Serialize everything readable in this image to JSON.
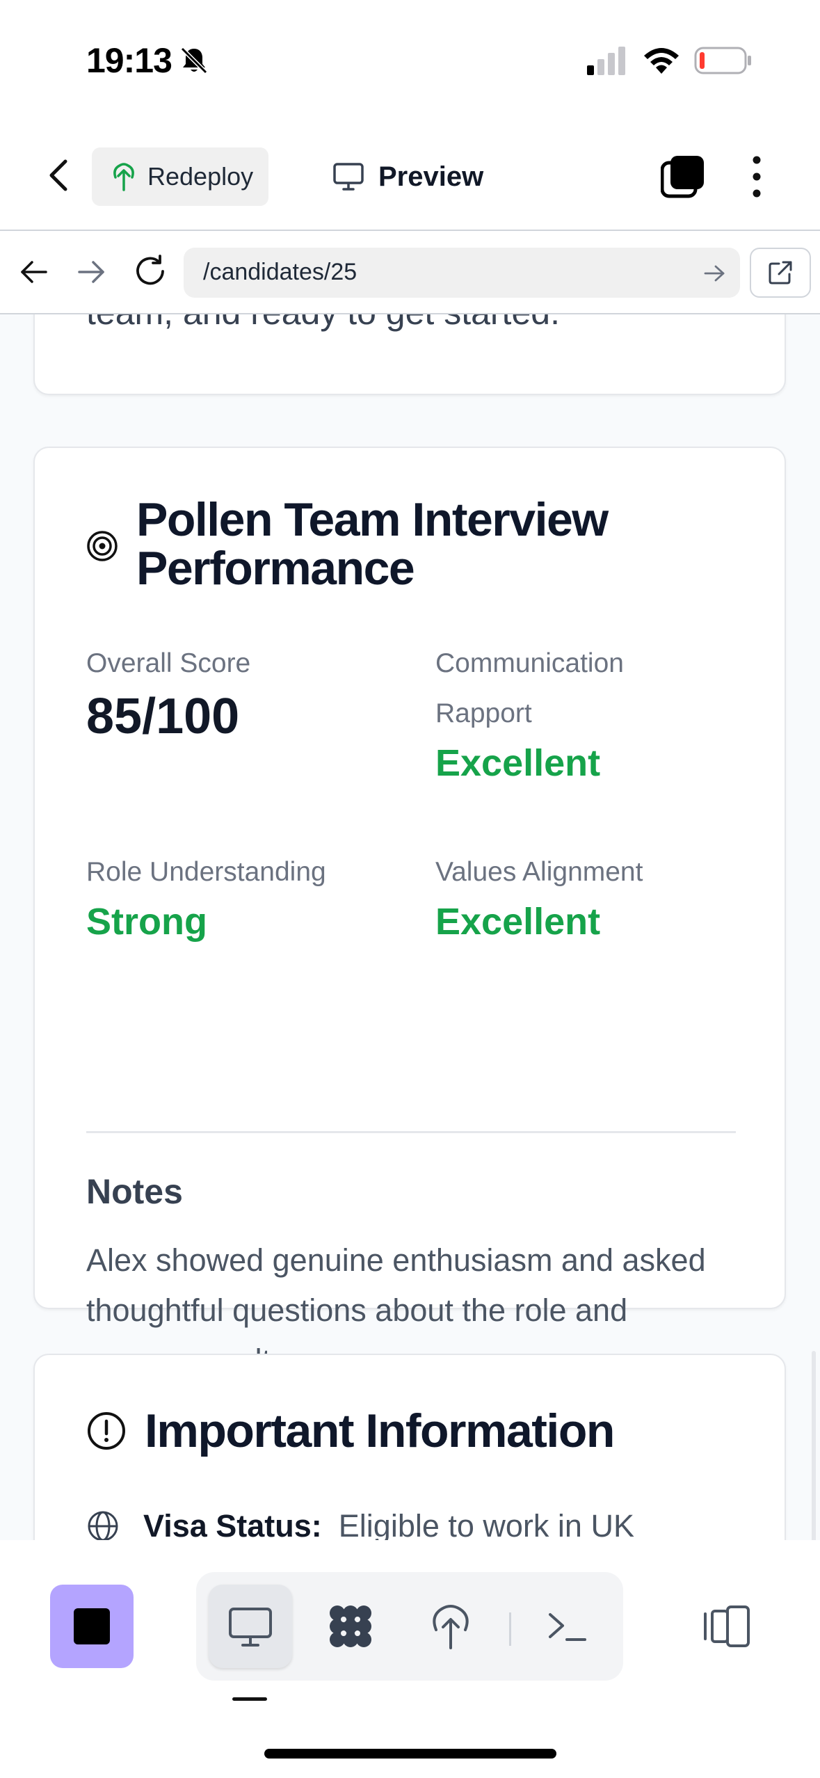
{
  "status_bar": {
    "time": "19:13"
  },
  "toolbar": {
    "redeploy_label": "Redeploy",
    "preview_label": "Preview"
  },
  "browser": {
    "url": "/candidates/25"
  },
  "previous_card": {
    "cut_text": "team, and ready to get started."
  },
  "interview_card": {
    "title": "Pollen Team Interview Performance",
    "overall_score_label": "Overall Score",
    "overall_score_value": "85/100",
    "communication_label": "Communication Rapport",
    "communication_value": "Excellent",
    "role_label": "Role Understanding",
    "role_value": "Strong",
    "values_label": "Values Alignment",
    "values_value": "Excellent",
    "notes_heading": "Notes",
    "notes_text": "Alex showed genuine enthusiasm and asked thoughtful questions about the role and company culture."
  },
  "important_card": {
    "title": "Important Information",
    "visa_label": "Visa Status:",
    "visa_value": "Eligible to work in UK"
  },
  "colors": {
    "accent_green": "#16a34a",
    "stop_button": "#b4a4ff"
  },
  "icons": {
    "status": [
      "bell-off-icon",
      "signal-icon",
      "wifi-icon",
      "battery-icon"
    ],
    "toolbar": [
      "chevron-left-icon",
      "tree-icon",
      "monitor-icon",
      "layers-icon",
      "kebab-icon"
    ],
    "browser": [
      "arrow-left-icon",
      "arrow-right-icon",
      "reload-icon",
      "external-link-icon"
    ],
    "bottom": [
      "stop-icon",
      "monitor-icon",
      "grid-icon",
      "tree-icon",
      "terminal-icon",
      "panel-icon"
    ]
  }
}
